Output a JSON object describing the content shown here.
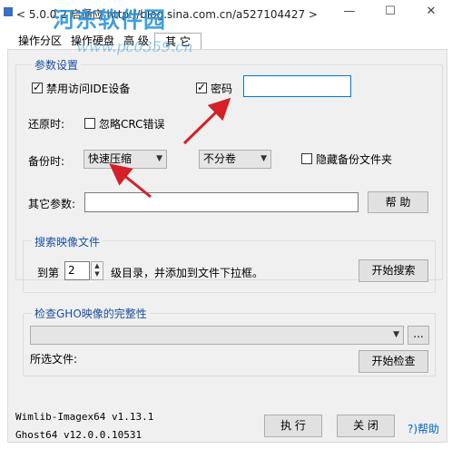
{
  "window": {
    "title": "< 5.0.0.2 启通应 http://blog.sina.com.cn/a527104427 >",
    "watermark_cn": "河东软件园",
    "watermark_url": "www.pc0359.cn",
    "minimize": "—",
    "maximize": "☐",
    "close": "✕"
  },
  "tabs": [
    "操作分区",
    "操作硬盘",
    "高 级",
    "其 它"
  ],
  "active_tab": 3,
  "params": {
    "legend": "参数设置",
    "disable_ide_label": "禁用访问IDE设备",
    "disable_ide_checked": true,
    "password_label": "密码",
    "password_checked": true,
    "password_value": "",
    "restore_label": "还原时:",
    "ignore_crc_label": "忽略CRC错误",
    "ignore_crc_checked": false,
    "backup_label": "备份时:",
    "compress_value": "快速压缩",
    "split_value": "不分卷",
    "hide_folder_label": "隐藏备份文件夹",
    "hide_folder_checked": false,
    "other_params_label": "其它参数:",
    "other_params_value": "",
    "help_button": "帮 助"
  },
  "search": {
    "legend": "搜索映像文件",
    "depth_prefix": "到第",
    "depth_value": "2",
    "depth_suffix": "级目录，并添加到文件下拉框。",
    "start_button": "开始搜索"
  },
  "check": {
    "legend": "检查GHO映像的完整性",
    "file_combo_value": "",
    "browse_button": "...",
    "selected_label": "所选文件:",
    "start_button": "开始检查"
  },
  "footer": {
    "wimlib": "Wimlib-Imagex64 v1.13.1",
    "ghost": "Ghost64 v12.0.0.10531",
    "execute_button": "执 行",
    "close_button": "关 闭",
    "help_link": "?)帮助"
  },
  "colors": {
    "arrow": "#d42026",
    "watermark": "#1f8fd6",
    "legend": "#1a4fa0",
    "help_link": "#0066cc"
  }
}
